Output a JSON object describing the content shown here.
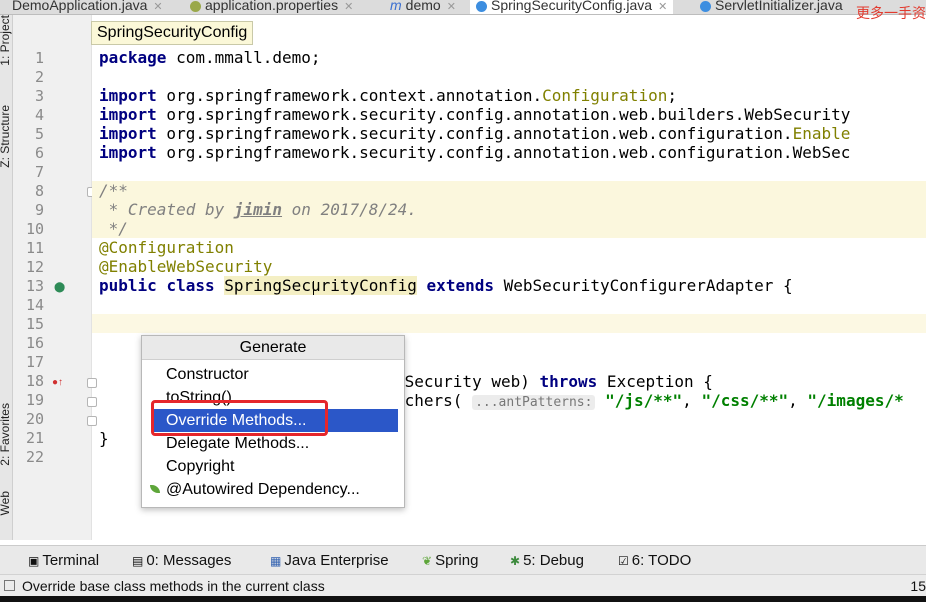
{
  "tabs": [
    {
      "label": "DemoApplication.java",
      "icon": "java-class-icon",
      "color": "#2e7bd6"
    },
    {
      "label": "application.properties",
      "icon": "properties-icon",
      "color": "#7b8e2e"
    },
    {
      "label": "demo",
      "icon": "module-icon",
      "color": "#3b6fd0"
    },
    {
      "label": "SpringSecurityConfig.java",
      "icon": "java-class-icon",
      "color": "#2e7bd6"
    },
    {
      "label": "ServletInitializer.java",
      "icon": "java-class-icon",
      "color": "#2e7bd6"
    }
  ],
  "watermark": "更多一手资",
  "left_strip": {
    "project": "1: Project",
    "structure": "Z: Structure",
    "favorites": "2: Favorites",
    "web": "Web"
  },
  "breadcrumb": "SpringSecurityConfig",
  "line_numbers": [
    "1",
    "2",
    "3",
    "4",
    "5",
    "6",
    "7",
    "8",
    "9",
    "10",
    "11",
    "12",
    "13",
    "14",
    "15",
    "16",
    "17",
    "18",
    "19",
    "20",
    "21",
    "22"
  ],
  "code": {
    "l1_kw": "package",
    "l1_rest": " com.mmall.demo;",
    "imp": "import",
    "l3_rest": " org.springframework.context.annotation.",
    "l3_ann": "Configuration",
    "l3_end": ";",
    "l4_rest": " org.springframework.security.config.annotation.web.builders.WebSecurity",
    "l5_rest": " org.springframework.security.config.annotation.web.configuration.",
    "l5_ann": "Enable",
    "l6_rest": " org.springframework.security.config.annotation.web.configuration.WebSec",
    "l8": "/**",
    "l9_a": " * Created by ",
    "l9_b": "jimin",
    "l9_c": " on 2017/8/24.",
    "l10": " */",
    "l11": "@Configuration",
    "l12": "@EnableWebSecurity",
    "l13_pub": "public",
    "l13_cls": "class",
    "l13_name": "SpringSecurityConfig",
    "l13_ext": "extends",
    "l13_rest": " WebSecurityConfigurerAdapter {",
    "l18_a": "bSecurity web) ",
    "l18_kw": "throws",
    "l18_b": " Exception {",
    "l19_a": "tchers( ",
    "l19_hint": "...antPatterns:",
    "l19_s1": "\"/js/**\"",
    "l19_c1": ", ",
    "l19_s2": "\"/css/**\"",
    "l19_c2": ", ",
    "l19_s3": "\"/images/*",
    "l21": "}"
  },
  "generate_menu": {
    "title": "Generate",
    "items": [
      "Constructor",
      "toString()",
      "Override Methods...",
      "Delegate Methods...",
      "Copyright",
      "@Autowired Dependency..."
    ],
    "selected_index": 2
  },
  "tool_windows": [
    {
      "label": "Terminal",
      "icon": "terminal-icon"
    },
    {
      "label": "0: Messages",
      "icon": "messages-icon"
    },
    {
      "label": "Java Enterprise",
      "icon": "java-enterprise-icon"
    },
    {
      "label": "Spring",
      "icon": "spring-leaf-icon"
    },
    {
      "label": "5: Debug",
      "icon": "debug-icon"
    },
    {
      "label": "6: TODO",
      "icon": "todo-icon"
    }
  ],
  "status": {
    "message": "Override base class methods in the current class",
    "position": "15"
  },
  "colors": {
    "selection": "#2b57c8",
    "highlight_box": "#e5262b",
    "keyword": "#000080",
    "annotation": "#808000",
    "string": "#008000",
    "comment": "#808080"
  }
}
